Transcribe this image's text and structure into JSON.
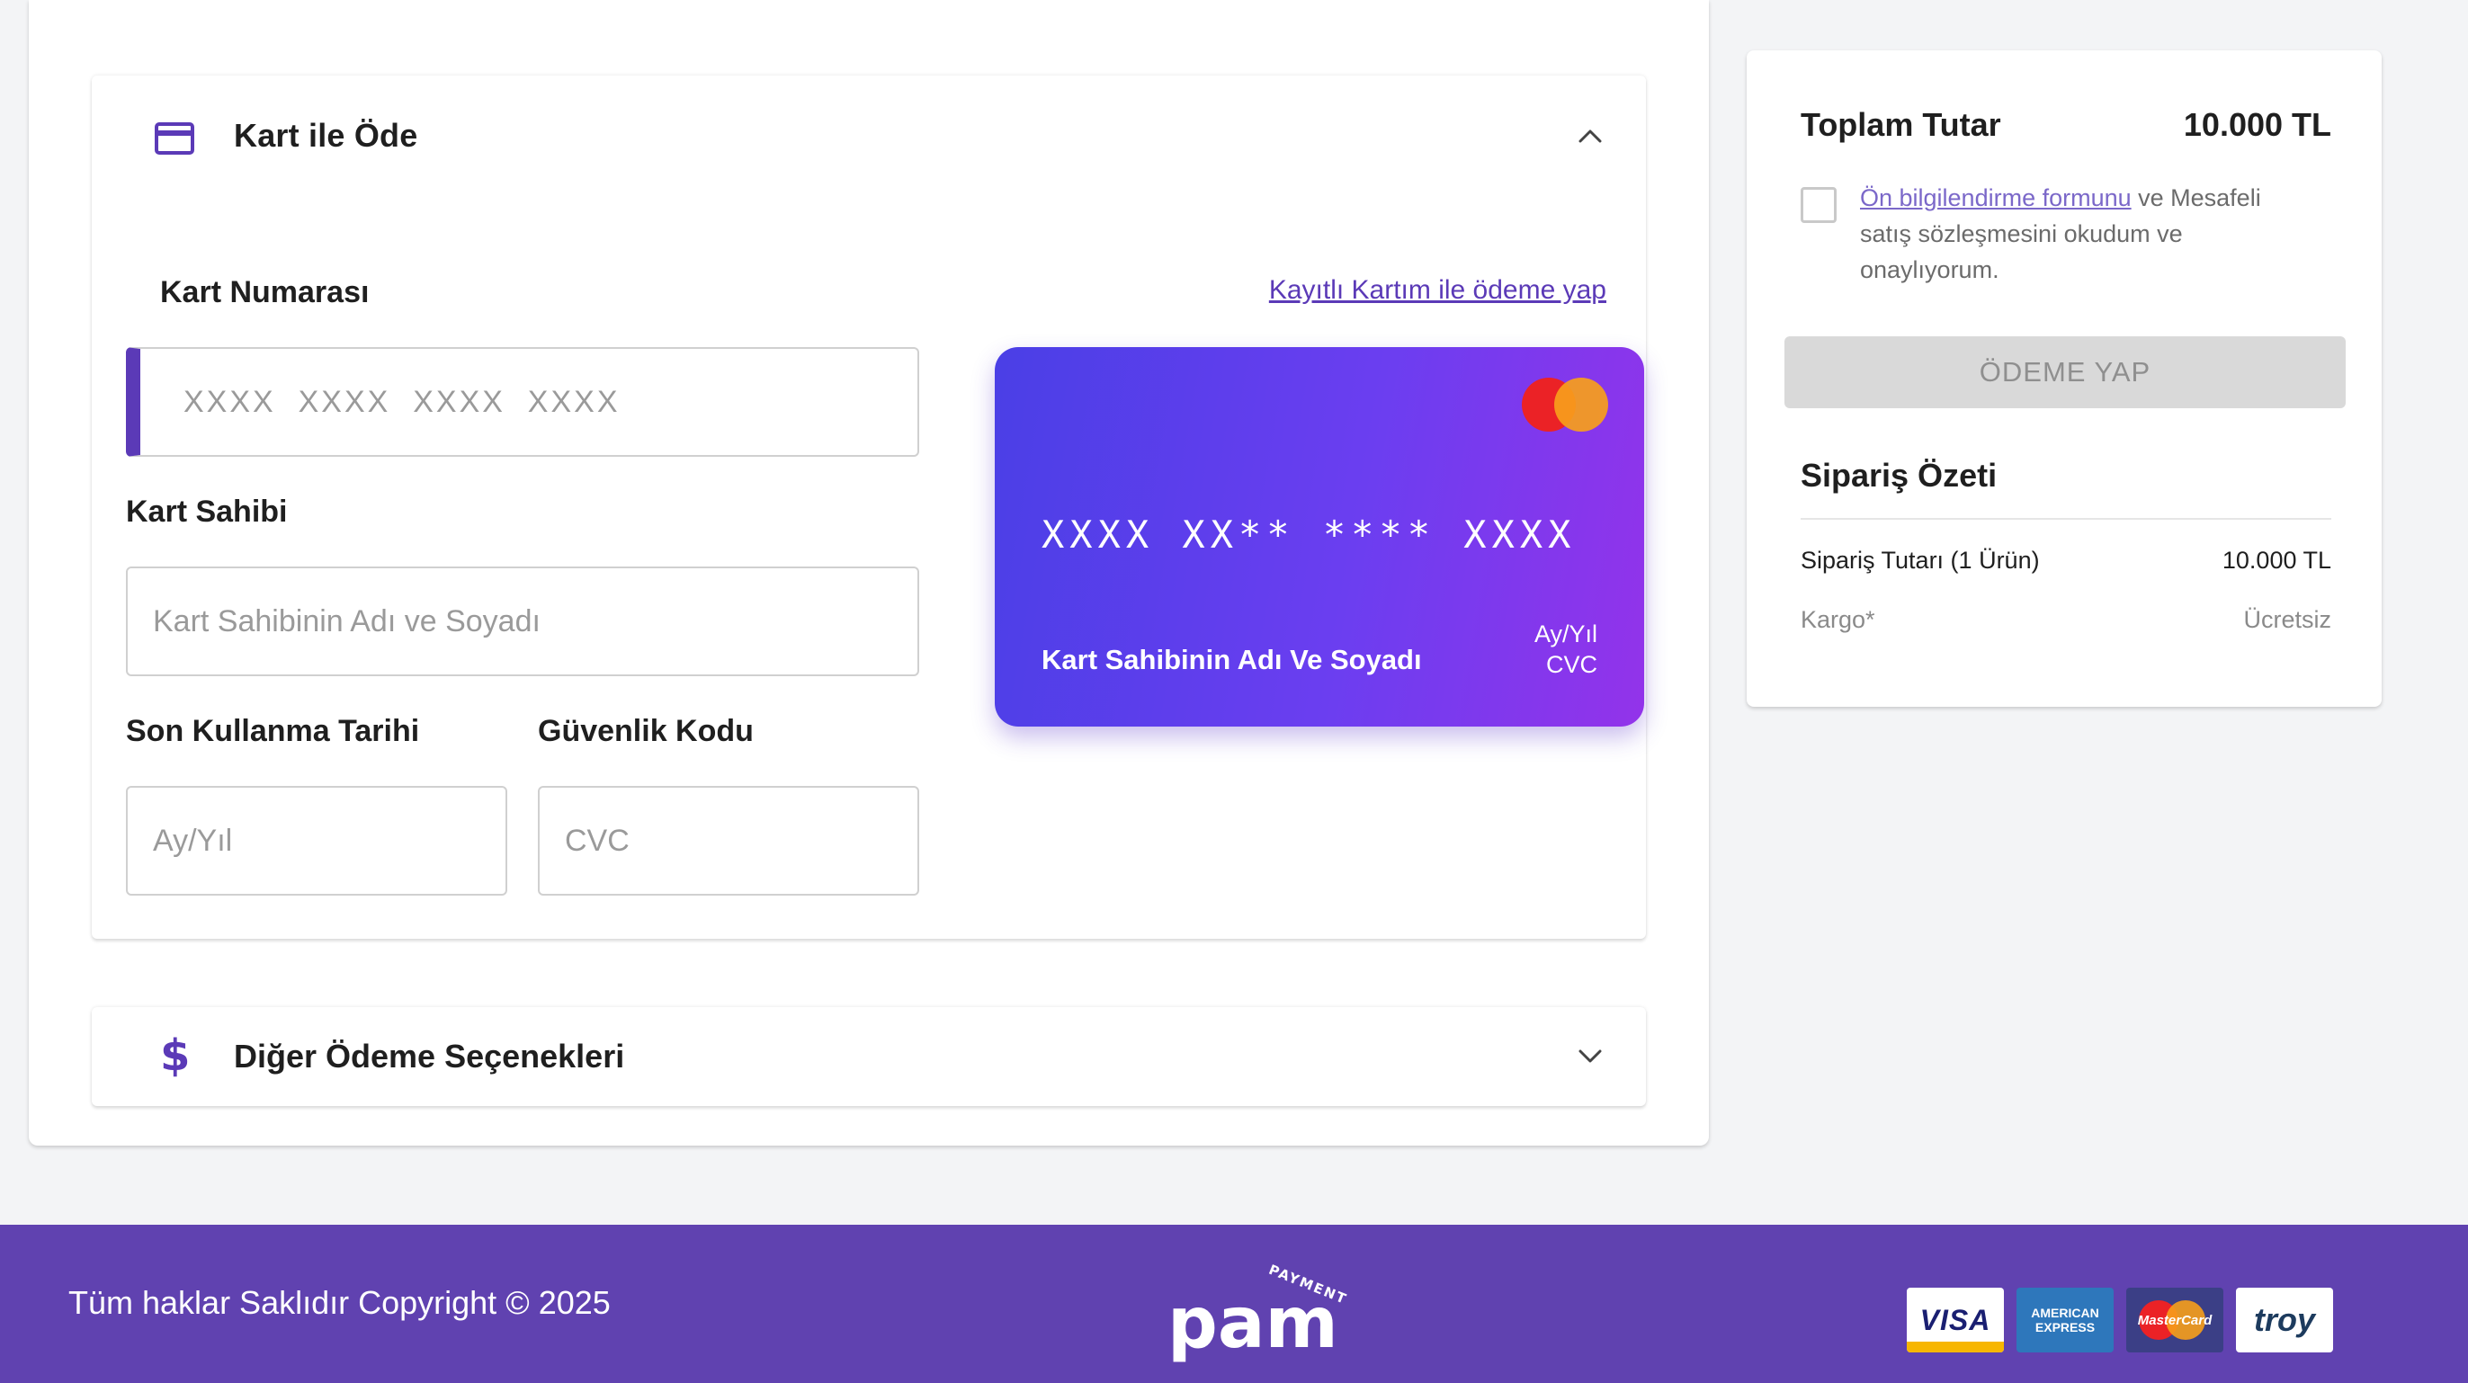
{
  "card_section": {
    "title": "Kart ile Öde",
    "card_number_label": "Kart Numarası",
    "saved_card_link": "Kayıtlı Kartım ile ödeme yap",
    "card_number_placeholder": "XXXX  XXXX  XXXX  XXXX",
    "holder_label": "Kart Sahibi",
    "holder_placeholder": "Kart Sahibinin Adı ve Soyadı",
    "expiry_label": "Son Kullanma Tarihi",
    "expiry_placeholder": "Ay/Yıl",
    "cvc_label": "Güvenlik Kodu",
    "cvc_placeholder": "CVC"
  },
  "visual_card": {
    "number": "XXXX XX** **** XXXX",
    "holder": "Kart Sahibinin Adı Ve Soyadı",
    "expiry": "Ay/Yıl",
    "cvc": "CVC",
    "gradient_start": "#4a3fe6",
    "gradient_end": "#9333ea",
    "brand_icon": "mastercard-icon"
  },
  "other_section": {
    "title": "Diğer Ödeme Seçenekleri",
    "icon": "dollar-icon"
  },
  "summary": {
    "total_label": "Toplam Tutar",
    "total_value": "10.000 TL",
    "terms_link": "Ön bilgilendirme formunu",
    "terms_text": " ve Mesafeli satış sözleşmesini okudum ve onaylıyorum.",
    "pay_button": "ÖDEME YAP",
    "order_summary_title": "Sipariş Özeti",
    "rows": [
      {
        "label": "Sipariş Tutarı (1 Ürün)",
        "value": "10.000 TL"
      },
      {
        "label": "Kargo*",
        "value": "Ücretsiz"
      }
    ]
  },
  "footer": {
    "copyright": "Tüm haklar Saklıdır Copyright © 2025",
    "brand": "pam",
    "brand_sub": "PAYMENT",
    "payment_logos": [
      "VISA",
      "AMERICAN EXPRESS",
      "MasterCard",
      "troy"
    ]
  },
  "colors": {
    "accent": "#5b3ab7",
    "footer_bg": "#6042b0",
    "page_bg": "#f3f4f6",
    "button_disabled": "#d9d9d9"
  }
}
